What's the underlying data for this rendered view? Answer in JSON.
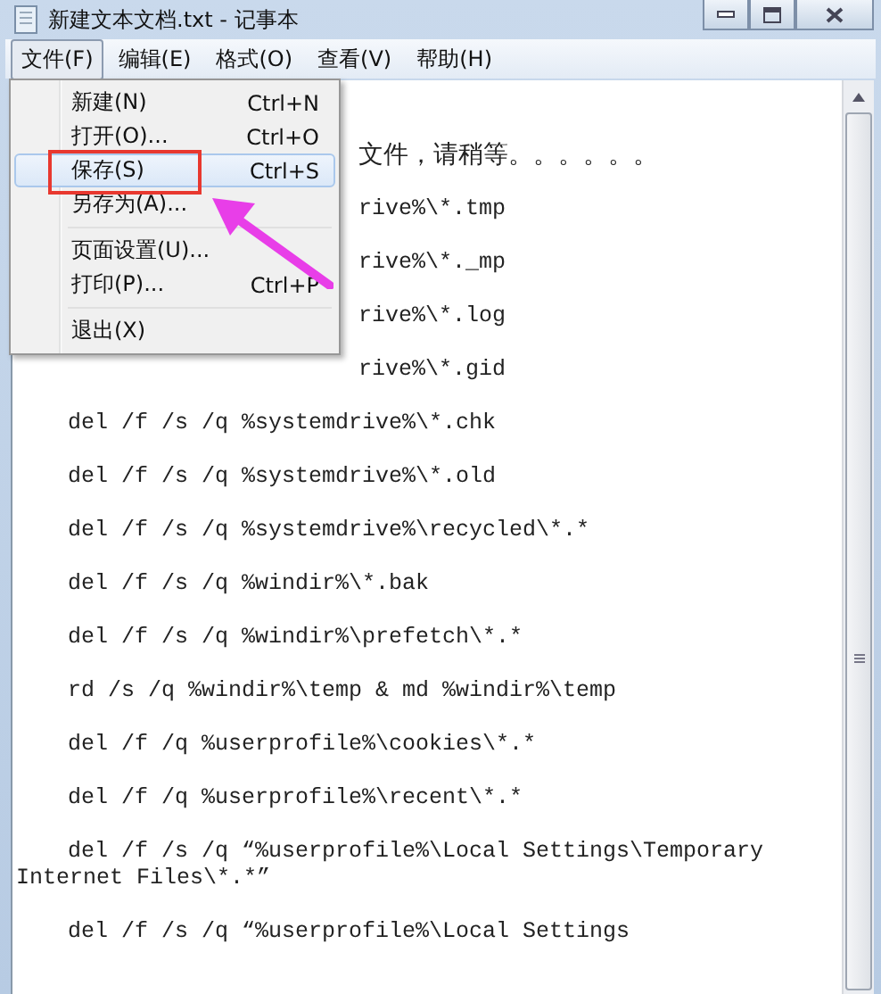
{
  "window": {
    "title": "新建文本文档.txt - 记事本"
  },
  "menubar": [
    {
      "label": "文件(F)",
      "selected": true
    },
    {
      "label": "编辑(E)",
      "selected": false
    },
    {
      "label": "格式(O)",
      "selected": false
    },
    {
      "label": "查看(V)",
      "selected": false
    },
    {
      "label": "帮助(H)",
      "selected": false
    }
  ],
  "menu": [
    {
      "kind": "item",
      "label": "新建(N)",
      "shortcut": "Ctrl+N",
      "selected": false
    },
    {
      "kind": "item",
      "label": "打开(O)...",
      "shortcut": "Ctrl+O",
      "selected": false
    },
    {
      "kind": "item",
      "label": "保存(S)",
      "shortcut": "Ctrl+S",
      "selected": true
    },
    {
      "kind": "item",
      "label": "另存为(A)...",
      "selected": false
    },
    {
      "kind": "separator"
    },
    {
      "kind": "item",
      "label": "页面设置(U)...",
      "selected": false
    },
    {
      "kind": "item",
      "label": "打印(P)...",
      "shortcut": "Ctrl+P",
      "selected": false
    },
    {
      "kind": "separator"
    },
    {
      "kind": "item",
      "label": "退出(X)",
      "selected": false
    }
  ],
  "editor": {
    "lines": [
      {
        "kind": "clipped",
        "text": "文件，请稍等。。。。。。"
      },
      {
        "kind": "clipped",
        "text": "rive%\\*.tmp"
      },
      {
        "kind": "clipped",
        "text": "rive%\\*._mp"
      },
      {
        "kind": "clipped",
        "text": "rive%\\*.log"
      },
      {
        "kind": "clipped",
        "text": "rive%\\*.gid"
      },
      {
        "kind": "line",
        "text": "del /f /s /q %systemdrive%\\*.chk"
      },
      {
        "kind": "line",
        "text": "del /f /s /q %systemdrive%\\*.old"
      },
      {
        "kind": "line",
        "text": "del /f /s /q %systemdrive%\\recycled\\*.*"
      },
      {
        "kind": "line",
        "text": "del /f /s /q %windir%\\*.bak"
      },
      {
        "kind": "line",
        "text": "del /f /s /q %windir%\\prefetch\\*.*"
      },
      {
        "kind": "line",
        "text": "rd /s /q %windir%\\temp & md %windir%\\temp"
      },
      {
        "kind": "line",
        "text": "del /f /q %userprofile%\\cookies\\*.*"
      },
      {
        "kind": "line",
        "text": "del /f /q %userprofile%\\recent\\*.*"
      },
      {
        "kind": "line",
        "text": "del /f /s /q “%userprofile%\\Local Settings\\Temporary Internet Files\\*.*”"
      },
      {
        "kind": "line",
        "text": "del /f /s /q “%userprofile%\\Local Settings"
      }
    ]
  }
}
